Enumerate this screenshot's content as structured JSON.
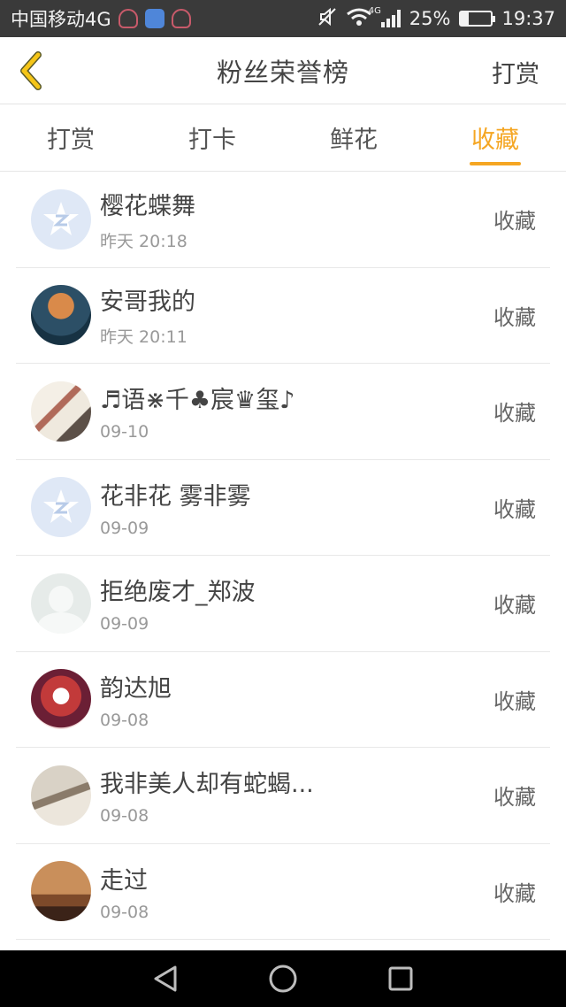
{
  "status_bar": {
    "carrier": "中国移动4G",
    "network_tag": "4G",
    "battery_percent": "25%",
    "battery_level": 0.25,
    "time": "19:37"
  },
  "nav": {
    "title": "粉丝荣誉榜",
    "action_label": "打赏"
  },
  "tabs": [
    {
      "label": "打赏",
      "active": false
    },
    {
      "label": "打卡",
      "active": false
    },
    {
      "label": "鲜花",
      "active": false
    },
    {
      "label": "收藏",
      "active": true
    }
  ],
  "list": [
    {
      "name": "樱花蝶舞",
      "time": "昨天 20:18",
      "action": "收藏",
      "avatar": "default-avatar-icon"
    },
    {
      "name": "安哥我的",
      "time": "昨天 20:11",
      "action": "收藏",
      "avatar": "user-avatar"
    },
    {
      "name": "♬语⋇千♣宸♛玺♪",
      "time": "09-10",
      "action": "收藏",
      "avatar": "user-avatar"
    },
    {
      "name": "花非花 雾非雾",
      "time": "09-09",
      "action": "收藏",
      "avatar": "default-avatar-icon"
    },
    {
      "name": "拒绝废才_郑波",
      "time": "09-09",
      "action": "收藏",
      "avatar": "placeholder-avatar-icon"
    },
    {
      "name": "韵达旭",
      "time": "09-08",
      "action": "收藏",
      "avatar": "user-avatar"
    },
    {
      "name": "我非美人却有蛇蝎...",
      "time": "09-08",
      "action": "收藏",
      "avatar": "user-avatar"
    },
    {
      "name": "走过",
      "time": "09-08",
      "action": "收藏",
      "avatar": "user-avatar"
    }
  ],
  "colors": {
    "accent": "#f5a623",
    "status_bar_bg": "#3a3a3a",
    "back_arrow": "#f5c518"
  }
}
